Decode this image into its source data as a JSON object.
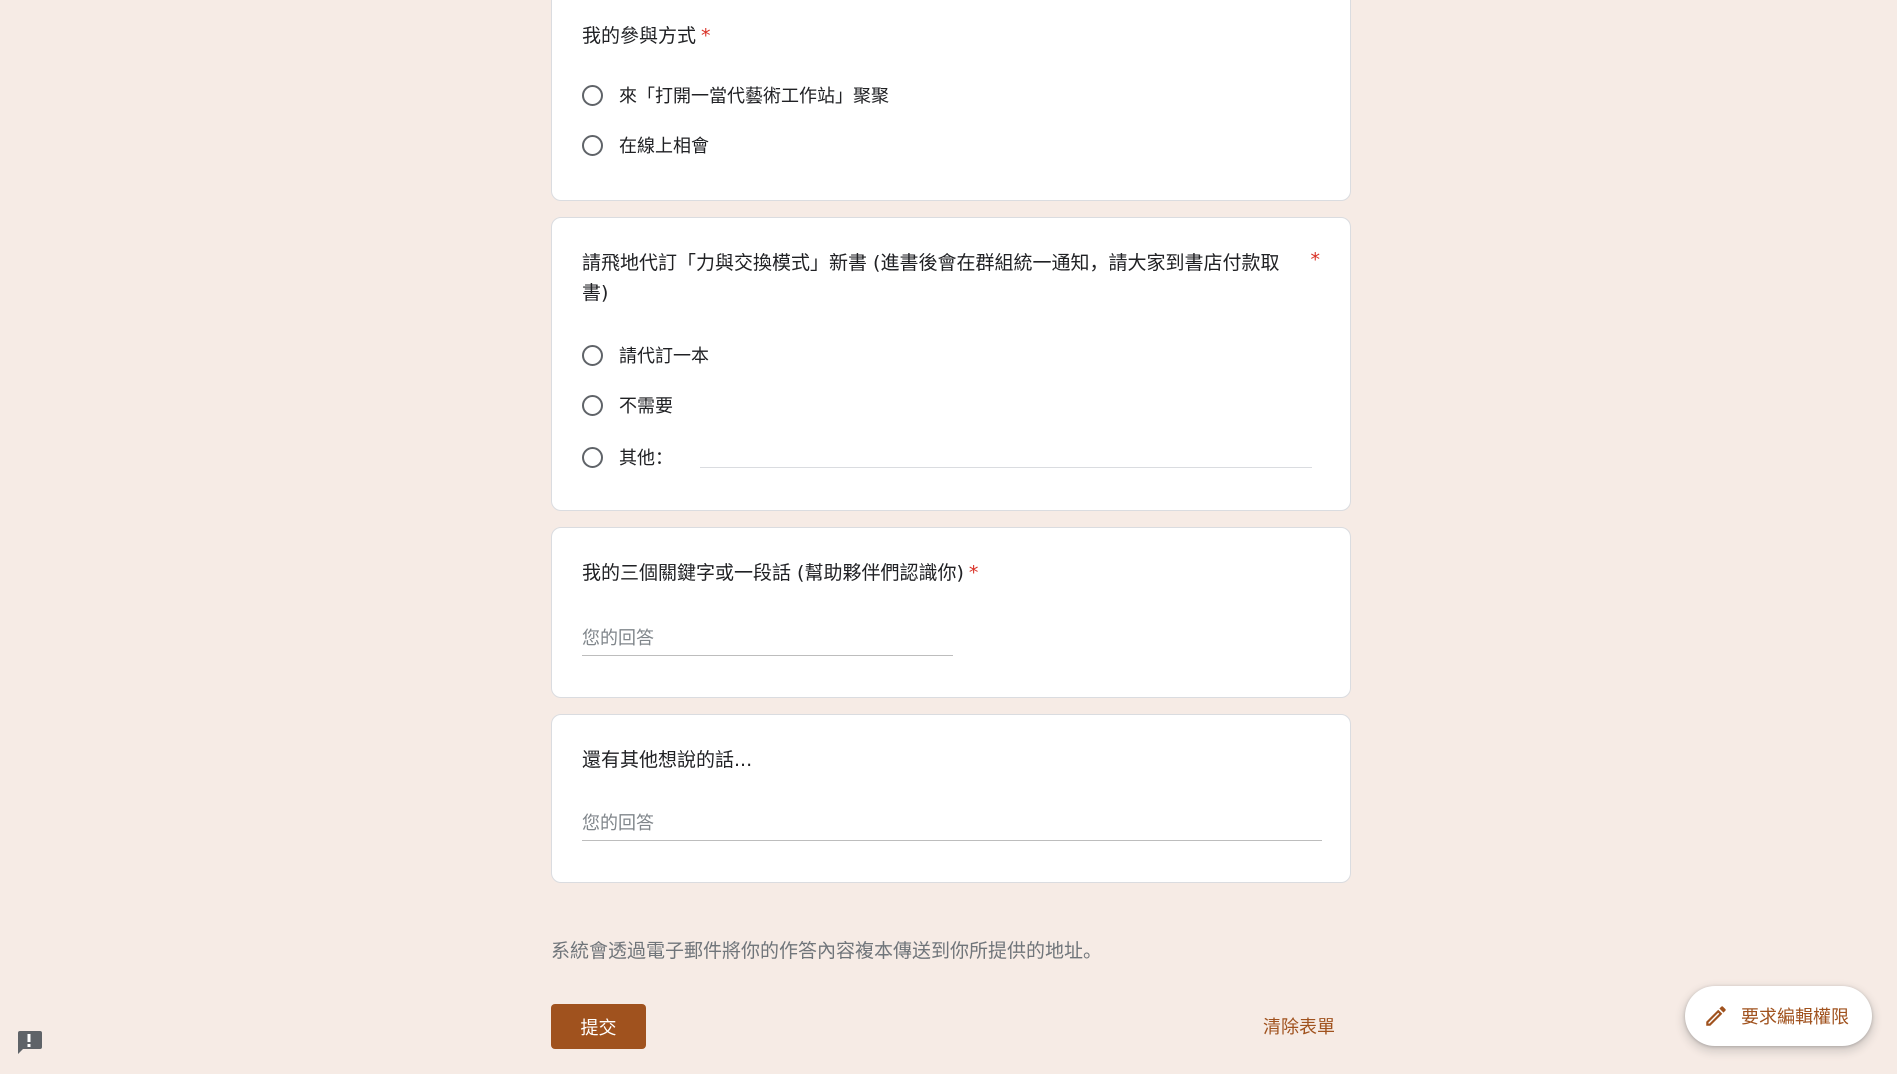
{
  "questions": {
    "q1": {
      "title": "我的參與方式",
      "required_mark": "*",
      "options": [
        "來「打開一當代藝術工作站」聚聚",
        "在線上相會"
      ]
    },
    "q2": {
      "title": "請飛地代訂「力與交換模式」新書 (進書後會在群組統一通知，請大家到書店付款取書)",
      "required_mark": "*",
      "options": [
        "請代訂一本",
        "不需要",
        "其他："
      ]
    },
    "q3": {
      "title": "我的三個關鍵字或一段話 (幫助夥伴們認識你)",
      "required_mark": "*",
      "placeholder": "您的回答"
    },
    "q4": {
      "title": "還有其他想說的話...",
      "placeholder": "您的回答"
    }
  },
  "footer": {
    "notice": "系統會透過電子郵件將你的作答內容複本傳送到你所提供的地址。",
    "submit_label": "提交",
    "clear_label": "清除表單"
  },
  "fab": {
    "label": "要求編輯權限",
    "icon": "pencil-icon"
  },
  "colors": {
    "background": "#f6ebe5",
    "accent": "#a0521e",
    "required": "#d93025"
  },
  "icons": {
    "feedback": "report-feedback-icon"
  }
}
